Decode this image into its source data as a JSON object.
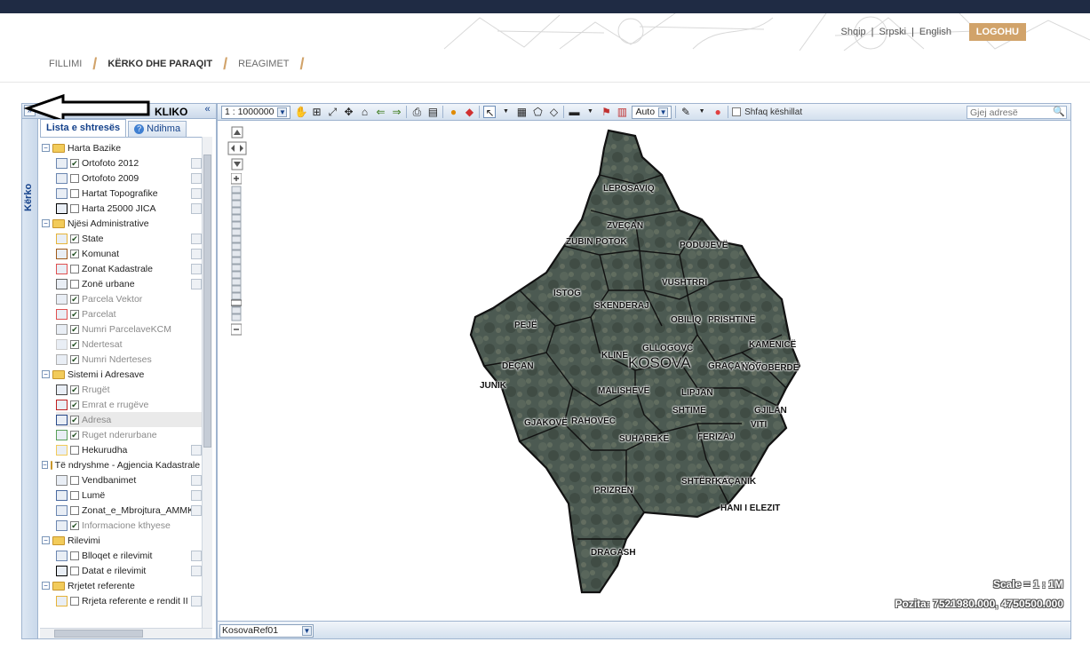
{
  "header": {
    "languages": [
      "Shqip",
      "Srpski",
      "English"
    ],
    "logout_label": "LOGOHU"
  },
  "nav": {
    "items": [
      "FILLIMI",
      "KËRKO DHE PARAQIT",
      "REAGIMET"
    ]
  },
  "left_panel": {
    "expand_glyph": "»",
    "collapse_glyph": "«",
    "kliko_label": "KLIKO",
    "side_title": "Kërko",
    "tabs": [
      {
        "label": "Lista e shtresës"
      },
      {
        "label": "Ndihma"
      }
    ],
    "layers": [
      {
        "label": "Harta Bazike",
        "kind": "group"
      },
      {
        "label": "Ortofoto 2012",
        "kind": "layer",
        "checked": true
      },
      {
        "label": "Ortofoto 2009",
        "kind": "layer",
        "checked": false
      },
      {
        "label": "Hartat Topografike",
        "kind": "layer",
        "checked": false
      },
      {
        "label": "Harta 25000 JICA",
        "kind": "layer",
        "checked": false
      },
      {
        "label": "Njësi Administrative",
        "kind": "group"
      },
      {
        "label": "State",
        "kind": "layer",
        "checked": true
      },
      {
        "label": "Komunat",
        "kind": "layer",
        "checked": true
      },
      {
        "label": "Zonat Kadastrale",
        "kind": "layer",
        "checked": false
      },
      {
        "label": "Zonë urbane",
        "kind": "layer",
        "checked": false
      },
      {
        "label": "Parcela Vektor",
        "kind": "layer",
        "checked": true,
        "dim": true
      },
      {
        "label": "Parcelat",
        "kind": "layer",
        "checked": true,
        "dim": true
      },
      {
        "label": "Numri ParcelaveKCM",
        "kind": "layer",
        "checked": true,
        "dim": true
      },
      {
        "label": "Ndertesat",
        "kind": "layer",
        "checked": true,
        "dim": true
      },
      {
        "label": "Numri Nderteses",
        "kind": "layer",
        "checked": true,
        "dim": true
      },
      {
        "label": "Sistemi i Adresave",
        "kind": "group"
      },
      {
        "label": "Rrugët",
        "kind": "layer",
        "checked": true,
        "dim": true
      },
      {
        "label": "Emrat e rrugëve",
        "kind": "layer",
        "checked": true,
        "dim": true
      },
      {
        "label": "Adresa",
        "kind": "layer",
        "checked": true,
        "dim": true,
        "highlight": true
      },
      {
        "label": "Ruget nderurbane",
        "kind": "layer",
        "checked": true,
        "dim": true
      },
      {
        "label": "Hekurudha",
        "kind": "layer",
        "checked": false
      },
      {
        "label": "Të ndryshme - Agjencia Kadastrale e Ko",
        "kind": "group"
      },
      {
        "label": "Vendbanimet",
        "kind": "layer",
        "checked": false
      },
      {
        "label": "Lumë",
        "kind": "layer",
        "checked": false
      },
      {
        "label": "Zonat_e_Mbrojtura_AMMK",
        "kind": "layer",
        "checked": false
      },
      {
        "label": "Informacione kthyese",
        "kind": "layer",
        "checked": true,
        "dim": true
      },
      {
        "label": "Rilevimi",
        "kind": "group"
      },
      {
        "label": "Blloqet e rilevimit",
        "kind": "layer",
        "checked": false
      },
      {
        "label": "Datat e rilevimit",
        "kind": "layer",
        "checked": false
      },
      {
        "label": "Rrjetet referente",
        "kind": "group"
      },
      {
        "label": "Rrjeta referente e rendit II",
        "kind": "layer",
        "checked": false
      }
    ]
  },
  "toolbar": {
    "scale_value": "1 : 1000000",
    "auto_value": "Auto",
    "hints_label": "Shfaq këshillat",
    "search_placeholder": "Gjej adresë"
  },
  "map": {
    "scale_text": "Scale = 1 : 1M",
    "position_text": "Pozita:  7521980.000, 4750500.000",
    "country_label": "KOSOVA",
    "municipalities": [
      "LEPOSAVIQ",
      "ZVEÇAN",
      "ZUBIN POTOK",
      "PODUJEVË",
      "VUSHTRRI",
      "ISTOG",
      "SKENDERAJ",
      "OBILIQ",
      "PRISHTINË",
      "PEJË",
      "KLINE",
      "GLLOGOVC",
      "KAMENICË",
      "DEÇAN",
      "GRAÇANICË",
      "NOVOBËRDË",
      "JUNIK",
      "LIPJAN",
      "MALISHEVË",
      "GJILAN",
      "SHTIME",
      "RAHOVEC",
      "GJAKOVË",
      "FERIZAJ",
      "VITI",
      "SUHAREKË",
      "PRIZREN",
      "SHTËRPCË",
      "KAÇANIK",
      "HANI I ELEZIT",
      "DRAGASH"
    ],
    "base_layer": "KosovaRef01"
  }
}
